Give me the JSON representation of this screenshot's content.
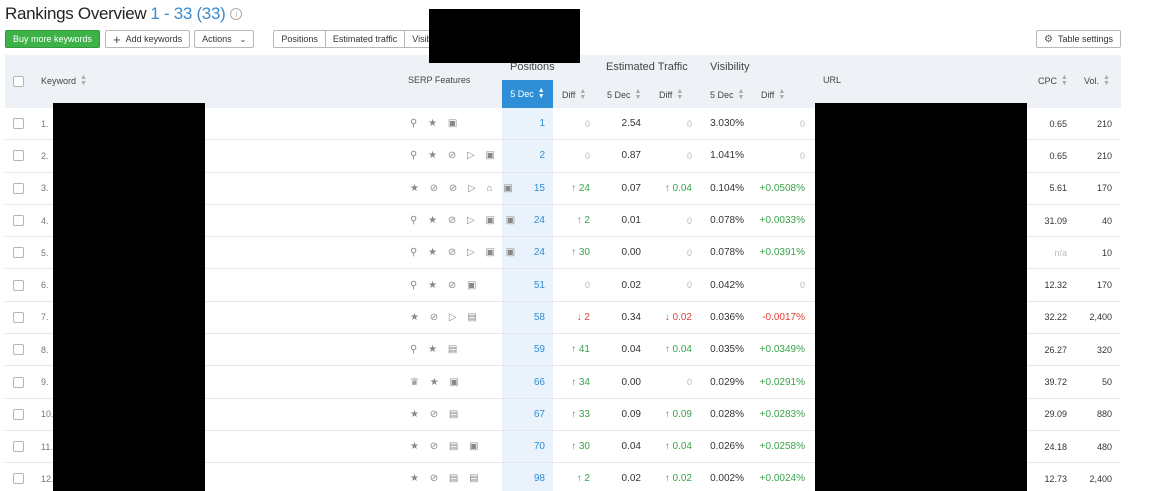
{
  "header": {
    "title": "Rankings Overview",
    "range": "1 - 33 (33)",
    "info_icon": "info-icon"
  },
  "toolbar": {
    "buy_label": "Buy more keywords",
    "add_label": "Add keywords",
    "actions_label": "Actions",
    "tabs": [
      "Positions",
      "Estimated traffic",
      "Visibility"
    ],
    "table_settings_label": "Table settings"
  },
  "columns": {
    "keyword": "Keyword",
    "serp": "SERP Features",
    "positions_group": "Positions",
    "traffic_group": "Estimated Traffic",
    "visibility_group": "Visibility",
    "date": "5 Dec",
    "diff": "Diff",
    "url": "URL",
    "cpc": "CPC",
    "vol": "Vol."
  },
  "rows": [
    {
      "n": "1.",
      "features": "⚲ ★ ▣",
      "pos": "1",
      "pos_diff": "0",
      "pos_dir": "zero",
      "traffic": "2.54",
      "traffic_diff": "0",
      "traffic_dir": "zero",
      "vis": "3.030%",
      "vis_diff": "0",
      "vis_dir": "zero",
      "cpc": "0.65",
      "vol": "210"
    },
    {
      "n": "2.",
      "features": "⚲ ★ ⊘ ▷ ▣",
      "pos": "2",
      "pos_diff": "0",
      "pos_dir": "zero",
      "traffic": "0.87",
      "traffic_diff": "0",
      "traffic_dir": "zero",
      "vis": "1.041%",
      "vis_diff": "0",
      "vis_dir": "zero",
      "cpc": "0.65",
      "vol": "210"
    },
    {
      "n": "3.",
      "features": "★ ⊘ ⊘ ▷ ⌂ ▣",
      "pos": "15",
      "pos_diff": "↑ 24",
      "pos_dir": "up",
      "traffic": "0.07",
      "traffic_diff": "↑ 0.04",
      "traffic_dir": "up",
      "vis": "0.104%",
      "vis_diff": "+0.0508%",
      "vis_dir": "up",
      "cpc": "5.61",
      "vol": "170"
    },
    {
      "n": "4.",
      "features": "⚲ ★ ⊘ ▷ ▣ ▣",
      "pos": "24",
      "pos_diff": "↑ 2",
      "pos_dir": "up",
      "traffic": "0.01",
      "traffic_diff": "0",
      "traffic_dir": "zero",
      "vis": "0.078%",
      "vis_diff": "+0.0033%",
      "vis_dir": "up",
      "cpc": "31.09",
      "vol": "40"
    },
    {
      "n": "5.",
      "features": "⚲ ★ ⊘ ▷ ▣ ▣",
      "pos": "24",
      "pos_diff": "↑ 30",
      "pos_dir": "up",
      "traffic": "0.00",
      "traffic_diff": "0",
      "traffic_dir": "zero",
      "vis": "0.078%",
      "vis_diff": "+0.0391%",
      "vis_dir": "up",
      "cpc": "n/a",
      "vol": "10"
    },
    {
      "n": "6.",
      "features": "⚲ ★ ⊘ ▣",
      "pos": "51",
      "pos_diff": "0",
      "pos_dir": "zero",
      "traffic": "0.02",
      "traffic_diff": "0",
      "traffic_dir": "zero",
      "vis": "0.042%",
      "vis_diff": "0",
      "vis_dir": "zero",
      "cpc": "12.32",
      "vol": "170"
    },
    {
      "n": "7.",
      "features": "★ ⊘ ▷ ▤",
      "pos": "58",
      "pos_diff": "↓ 2",
      "pos_dir": "down",
      "traffic": "0.34",
      "traffic_diff": "↓ 0.02",
      "traffic_dir": "down",
      "vis": "0.036%",
      "vis_diff": "-0.0017%",
      "vis_dir": "down",
      "cpc": "32.22",
      "vol": "2,400"
    },
    {
      "n": "8.",
      "features": "⚲ ★ ▤",
      "pos": "59",
      "pos_diff": "↑ 41",
      "pos_dir": "up",
      "traffic": "0.04",
      "traffic_diff": "↑ 0.04",
      "traffic_dir": "up",
      "vis": "0.035%",
      "vis_diff": "+0.0349%",
      "vis_dir": "up",
      "cpc": "26.27",
      "vol": "320"
    },
    {
      "n": "9.",
      "features": "♛ ★ ▣",
      "pos": "66",
      "pos_diff": "↑ 34",
      "pos_dir": "up",
      "traffic": "0.00",
      "traffic_diff": "0",
      "traffic_dir": "zero",
      "vis": "0.029%",
      "vis_diff": "+0.0291%",
      "vis_dir": "up",
      "cpc": "39.72",
      "vol": "50"
    },
    {
      "n": "10.",
      "features": "★ ⊘ ▤",
      "pos": "67",
      "pos_diff": "↑ 33",
      "pos_dir": "up",
      "traffic": "0.09",
      "traffic_diff": "↑ 0.09",
      "traffic_dir": "up",
      "vis": "0.028%",
      "vis_diff": "+0.0283%",
      "vis_dir": "up",
      "cpc": "29.09",
      "vol": "880"
    },
    {
      "n": "11.",
      "features": "★ ⊘ ▤ ▣",
      "pos": "70",
      "pos_diff": "↑ 30",
      "pos_dir": "up",
      "traffic": "0.04",
      "traffic_diff": "↑ 0.04",
      "traffic_dir": "up",
      "vis": "0.026%",
      "vis_diff": "+0.0258%",
      "vis_dir": "up",
      "cpc": "24.18",
      "vol": "480"
    },
    {
      "n": "12.",
      "features": "★ ⊘ ▤ ▤",
      "pos": "98",
      "pos_diff": "↑ 2",
      "pos_dir": "up",
      "traffic": "0.02",
      "traffic_diff": "↑ 0.02",
      "traffic_dir": "up",
      "vis": "0.002%",
      "vis_diff": "+0.0024%",
      "vis_dir": "up",
      "cpc": "12.73",
      "vol": "2,400"
    }
  ]
}
